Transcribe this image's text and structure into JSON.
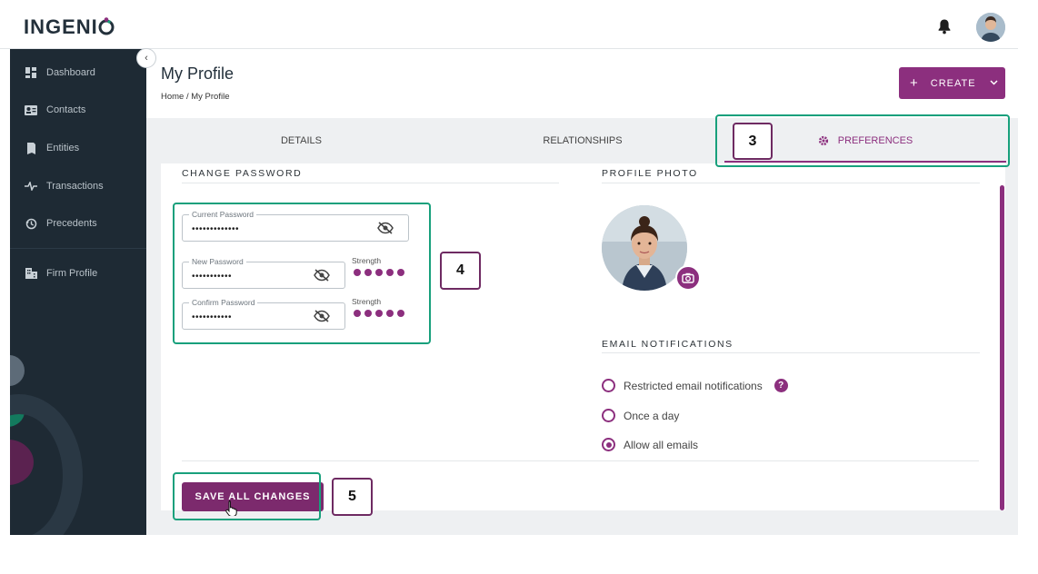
{
  "app": {
    "logo_text": "INGENI",
    "logo_o": "O"
  },
  "sidebar": {
    "items": [
      {
        "label": "Dashboard",
        "icon": "dashboard-icon"
      },
      {
        "label": "Contacts",
        "icon": "contacts-icon"
      },
      {
        "label": "Entities",
        "icon": "entities-icon"
      },
      {
        "label": "Transactions",
        "icon": "transactions-icon"
      },
      {
        "label": "Precedents",
        "icon": "precedents-icon"
      },
      {
        "label": "Firm Profile",
        "icon": "firm-profile-icon"
      }
    ]
  },
  "header": {
    "title": "My Profile",
    "breadcrumb": "Home / My Profile",
    "create_label": "CREATE"
  },
  "tabs": [
    {
      "label": "DETAILS"
    },
    {
      "label": "RELATIONSHIPS"
    },
    {
      "label": "PREFERENCES",
      "active": true
    }
  ],
  "password": {
    "section_title": "CHANGE PASSWORD",
    "current_label": "Current Password",
    "current_value": "•••••••••••••",
    "new_label": "New Password",
    "new_value": "•••••••••••",
    "confirm_label": "Confirm Password",
    "confirm_value": "•••••••••••",
    "strength_label": "Strength"
  },
  "photo": {
    "section_title": "PROFILE PHOTO"
  },
  "notifications": {
    "section_title": "EMAIL NOTIFICATIONS",
    "options": [
      {
        "label": "Restricted email notifications",
        "checked": false
      },
      {
        "label": "Once a day",
        "checked": false
      },
      {
        "label": "Allow all emails",
        "checked": true
      }
    ]
  },
  "footer": {
    "save_label": "SAVE ALL CHANGES"
  },
  "callouts": [
    "3",
    "4",
    "5"
  ],
  "colors": {
    "brand": "#8c2f7e",
    "sidebar": "#1e2a34",
    "highlight": "#18a07c"
  }
}
